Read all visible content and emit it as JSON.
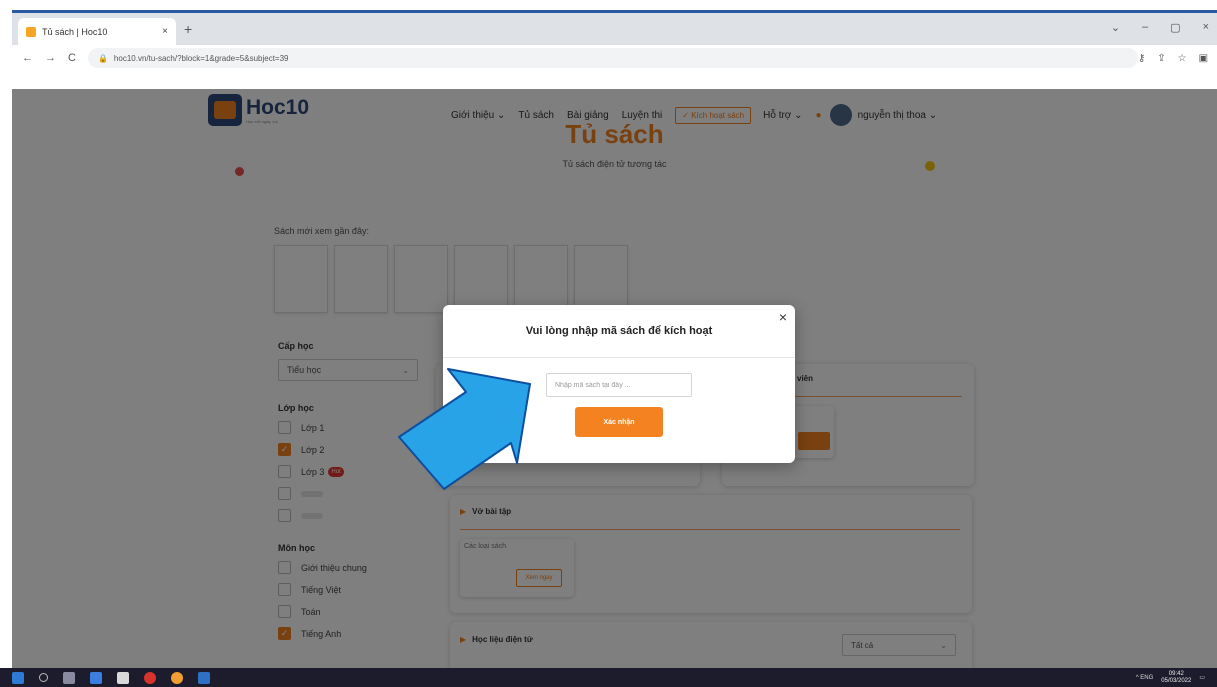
{
  "browser": {
    "tab_title": "Tủ sách | Hoc10",
    "tab_close": "×",
    "new_tab": "+",
    "window_controls": [
      "⌄",
      "–",
      "▢",
      "×"
    ],
    "nav": [
      "←",
      "→",
      "C"
    ],
    "url": "hoc10.vn/tu-sach/?block=1&grade=5&subject=39"
  },
  "header": {
    "logo_name": "Hoc10",
    "logo_sub": "Học mỗi ngày, vui",
    "nav_items": [
      "Giới thiệu ⌄",
      "Tủ sách",
      "Bài giảng",
      "Luyện thi"
    ],
    "activate_label": "✓ Kích hoạt sách",
    "support_label": "Hỗ trợ ⌄",
    "bell_icon": "bell-icon",
    "user_name": "nguyễn thị thoa ⌄"
  },
  "page": {
    "title": "Tủ sách",
    "subtitle": "Tủ sách điện tử tương tác",
    "recent_label": "Sách mới xem gần đây:"
  },
  "sidebar": {
    "cap_hoc_label": "Cấp học",
    "cap_hoc_value": "Tiểu học",
    "lop_hoc_label": "Lớp học",
    "grades": [
      {
        "label": "Lớp 1",
        "checked": false
      },
      {
        "label": "Lớp 2",
        "checked": true
      },
      {
        "label": "Lớp 3",
        "checked": false,
        "badge": "Hot"
      }
    ],
    "mon_hoc_label": "Môn học",
    "subjects": [
      {
        "label": "Giới thiệu chung",
        "checked": false
      },
      {
        "label": "Tiếng Việt",
        "checked": false
      },
      {
        "label": "Toán",
        "checked": false
      },
      {
        "label": "Tiếng Anh",
        "checked": true
      }
    ]
  },
  "cards": {
    "top_right_title": "viên",
    "exercise_title": "Vở bài tập",
    "exercise_item": "Các loại sách",
    "exercise_button": "Xem ngay",
    "materials_title": "Học liệu điện tử",
    "materials_filter": "Tất cả"
  },
  "modal": {
    "title": "Vui lòng nhập mã sách để kích hoạt",
    "input_placeholder": "Nhập mã sách tại đây ...",
    "input_value": "",
    "confirm_label": "Xác nhận",
    "close_label": "×"
  },
  "taskbar": {
    "tray_text": "^ ENG",
    "time": "09:42",
    "date": "05/03/2022"
  },
  "colors": {
    "brand_orange": "#f58220",
    "brand_navy": "#2d4a7a",
    "arrow_blue": "#29a3e8"
  }
}
